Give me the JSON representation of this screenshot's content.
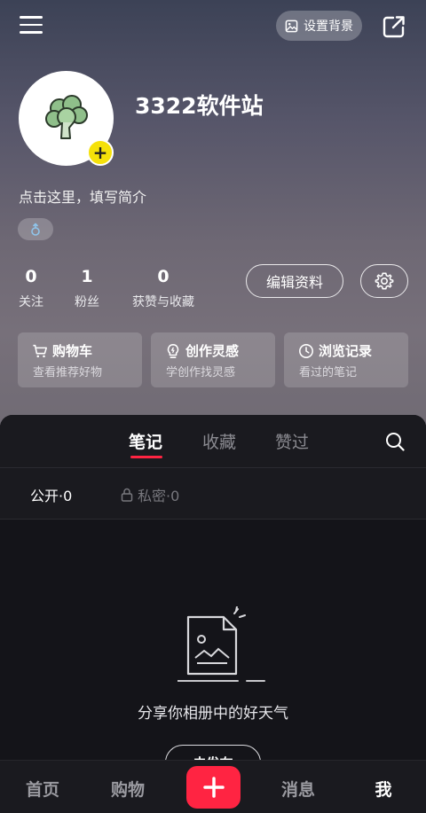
{
  "header": {
    "set_background_label": "设置背景"
  },
  "profile": {
    "username": "3322软件站",
    "bio": "点击这里，填写简介"
  },
  "stats": [
    {
      "value": "0",
      "label": "关注"
    },
    {
      "value": "1",
      "label": "粉丝"
    },
    {
      "value": "0",
      "label": "获赞与收藏"
    }
  ],
  "actions": {
    "edit_profile_label": "编辑资料"
  },
  "features": [
    {
      "title": "购物车",
      "subtitle": "查看推荐好物",
      "icon": "cart-icon"
    },
    {
      "title": "创作灵感",
      "subtitle": "学创作找灵感",
      "icon": "lightbulb-icon"
    },
    {
      "title": "浏览记录",
      "subtitle": "看过的笔记",
      "icon": "clock-icon"
    }
  ],
  "tabs": [
    {
      "label": "笔记",
      "active": true
    },
    {
      "label": "收藏",
      "active": false
    },
    {
      "label": "赞过",
      "active": false
    }
  ],
  "subtabs": {
    "public": "公开·0",
    "private": "私密·0"
  },
  "empty_state": {
    "message": "分享你相册中的好天气",
    "button_label": "去发布"
  },
  "bottom_nav": [
    {
      "label": "首页",
      "active": false
    },
    {
      "label": "购物",
      "active": false
    },
    {
      "label": "消息",
      "active": false
    },
    {
      "label": "我",
      "active": true
    }
  ],
  "colors": {
    "accent": "#ff2442",
    "avatar_badge": "#f5e10a"
  }
}
